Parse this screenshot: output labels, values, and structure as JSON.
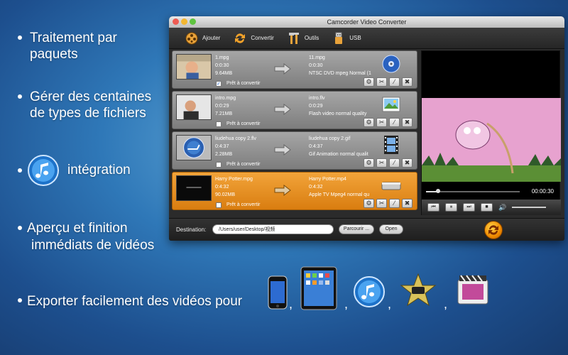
{
  "promo": {
    "line1a": "Traitement par",
    "line1b": "paquets",
    "line2a": "Gérer des centaines",
    "line2b": "de types de fichiers",
    "line3": "intégration",
    "line4a": "Aperçu et finition",
    "line4b": "immédiats de vidéos",
    "line5": "Exporter facilement des vidéos pour",
    "separator": ","
  },
  "window": {
    "title": "Camcorder Video Converter",
    "toolbar": {
      "add_label": "Ajouter",
      "convert_label": "Convertir",
      "tools_label": "Outils",
      "usb_label": "USB"
    },
    "rows": [
      {
        "src_name": "1.mpg",
        "src_time": "0:0:30",
        "src_size": "9.64MB",
        "dst_name": "11.mpg",
        "dst_time": "0:0:30",
        "dst_format": "NTSC DVD mpeg Normal (1",
        "ready": "Prêt à convertir",
        "checked": "✓"
      },
      {
        "src_name": "intro.mpg",
        "src_time": "0:0:29",
        "src_size": "7.21MB",
        "dst_name": "intro.flv",
        "dst_time": "0:0:29",
        "dst_format": "Flash video normal quality",
        "ready": "Prêt à convertir",
        "checked": ""
      },
      {
        "src_name": "liudehua copy 2.flv",
        "src_time": "0:4:37",
        "src_size": "2.28MB",
        "dst_name": "liudehua copy 2.gif",
        "dst_time": "0:4:37",
        "dst_format": "Gif Animation normal qualit",
        "ready": "Prêt à convertir",
        "checked": ""
      },
      {
        "src_name": "Harry Potter.mpg",
        "src_time": "0:4:32",
        "src_size": "90.02MB",
        "dst_name": "Harry Potter.mp4",
        "dst_time": "0:4:32",
        "dst_format": "Apple TV Mpeg4 normal qu",
        "ready": "Prêt à convertir",
        "checked": ""
      }
    ],
    "preview": {
      "timecode": "00:00:30"
    },
    "bottom": {
      "dest_label": "Destination:",
      "dest_path": "/Users/user/Desktop/视频",
      "browse_label": "Parcourir ...",
      "open_label": "Open"
    }
  },
  "colors": {
    "accent": "#e98c1c",
    "row_bg": "#8e8e8e"
  }
}
